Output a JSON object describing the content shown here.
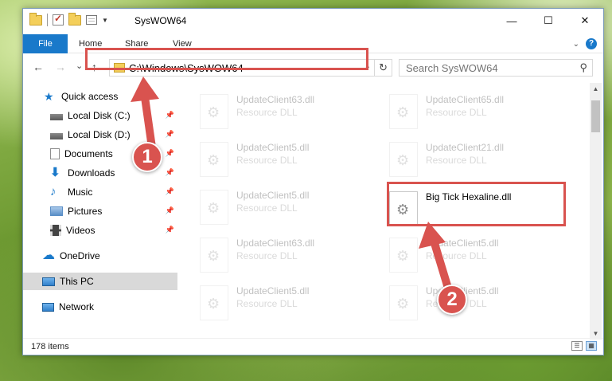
{
  "window": {
    "title": "SysWOW64",
    "controls": {
      "minimize": "—",
      "maximize": "☐",
      "close": "✕"
    }
  },
  "ribbon": {
    "tabs": [
      "File",
      "Home",
      "Share",
      "View"
    ],
    "expand_icon": "chevron-down-icon",
    "help": "?"
  },
  "nav": {
    "back": "←",
    "forward": "→",
    "recent": "⌄",
    "up": "↑",
    "address": "C:\\Windows\\SysWOW64",
    "address_dropdown": "⌄",
    "refresh": "↻",
    "search_placeholder": "Search SysWOW64",
    "search_icon": "⚲"
  },
  "sidebar": {
    "items": [
      {
        "label": "Quick access",
        "icon": "star-icon",
        "color": "#1979ca",
        "pinned": false
      },
      {
        "label": "Local Disk (C:)",
        "icon": "drive-icon",
        "color": "#7a7a7a",
        "pinned": true
      },
      {
        "label": "Local Disk (D:)",
        "icon": "drive-icon",
        "color": "#7a7a7a",
        "pinned": true
      },
      {
        "label": "Documents",
        "icon": "documents-icon",
        "color": "#8f8f8f",
        "pinned": true
      },
      {
        "label": "Downloads",
        "icon": "download-icon",
        "color": "#1979ca",
        "pinned": true
      },
      {
        "label": "Music",
        "icon": "music-icon",
        "color": "#1979ca",
        "pinned": true
      },
      {
        "label": "Pictures",
        "icon": "pictures-icon",
        "color": "#5b8fc7",
        "pinned": true
      },
      {
        "label": "Videos",
        "icon": "videos-icon",
        "color": "#444444",
        "pinned": true
      },
      {
        "label": "OneDrive",
        "icon": "cloud-icon",
        "color": "#1979ca",
        "pinned": false
      },
      {
        "label": "This PC",
        "icon": "computer-icon",
        "color": "#3a87cf",
        "pinned": false,
        "selected": true
      },
      {
        "label": "Network",
        "icon": "network-icon",
        "color": "#3a87cf",
        "pinned": false
      }
    ],
    "pin_glyph": "📌"
  },
  "files": [
    {
      "name": "UpdateClient63.dll",
      "type": "Resource DLL",
      "faded": true
    },
    {
      "name": "UpdateClient65.dll",
      "type": "Resource DLL",
      "faded": true
    },
    {
      "name": "UpdateClient5.dll",
      "type": "Resource DLL",
      "faded": true
    },
    {
      "name": "UpdateClient21.dll",
      "type": "Resource DLL",
      "faded": true
    },
    {
      "name": "UpdateClient5.dll",
      "type": "Resource DLL",
      "faded": true
    },
    {
      "name": "Big Tick Hexaline.dll",
      "type": "",
      "faded": false
    },
    {
      "name": "UpdateClient63.dll",
      "type": "Resource DLL",
      "faded": true
    },
    {
      "name": "UpdateClient5.dll",
      "type": "Resource DLL",
      "faded": true
    },
    {
      "name": "UpdateClient5.dll",
      "type": "Resource DLL",
      "faded": true
    },
    {
      "name": "UpdateClient5.dll",
      "type": "Resource DLL",
      "faded": true
    }
  ],
  "status": {
    "count": "178 items"
  },
  "annotations": {
    "step1": "1",
    "step2": "2",
    "color": "#d9534f"
  }
}
